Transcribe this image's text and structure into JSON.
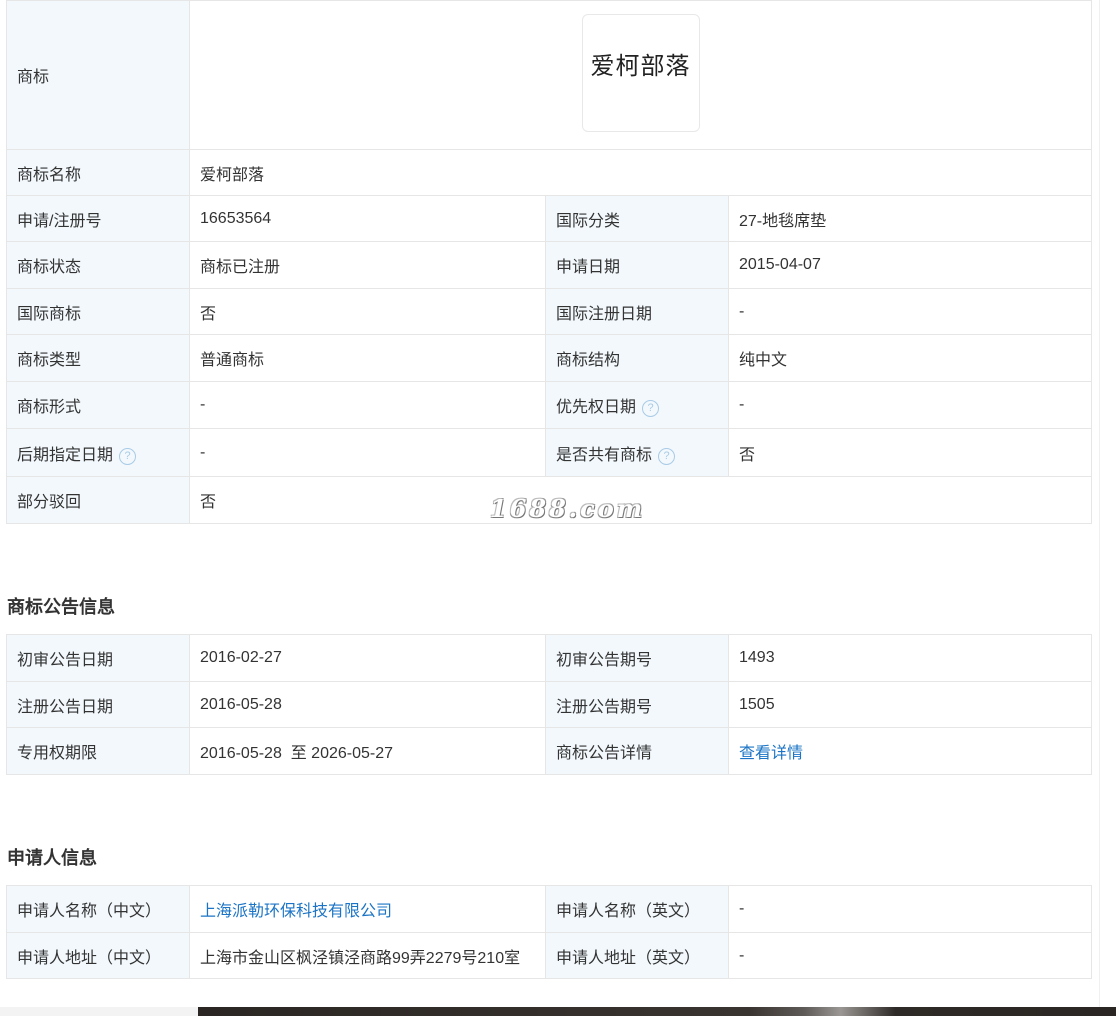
{
  "trademark": {
    "logo_label": "商标",
    "logo_text": "爱柯部落",
    "rows": [
      {
        "label": "商标名称",
        "value": "爱柯部落"
      },
      {
        "label": "申请/注册号",
        "value": "16653564",
        "label2": "国际分类",
        "value2": "27-地毯席垫"
      },
      {
        "label": "商标状态",
        "value": "商标已注册",
        "label2": "申请日期",
        "value2": "2015-04-07"
      },
      {
        "label": "国际商标",
        "value": "否",
        "label2": "国际注册日期",
        "value2": "-"
      },
      {
        "label": "商标类型",
        "value": "普通商标",
        "label2": "商标结构",
        "value2": "纯中文"
      },
      {
        "label": "商标形式",
        "value": "-",
        "label2": "优先权日期",
        "value2": "-"
      },
      {
        "label": "后期指定日期",
        "value": "-",
        "label2": "是否共有商标",
        "value2": "否"
      },
      {
        "label": "部分驳回",
        "value": "否"
      }
    ],
    "help_icon": "?"
  },
  "watermark": "1688.com",
  "announcement": {
    "title": "商标公告信息",
    "rows": [
      {
        "label": "初审公告日期",
        "value": "2016-02-27",
        "label2": "初审公告期号",
        "value2": "1493"
      },
      {
        "label": "注册公告日期",
        "value": "2016-05-28",
        "label2": "注册公告期号",
        "value2": "1505"
      },
      {
        "label": "专用权期限",
        "value": "2016-05-28  至 2026-05-27",
        "label2": "商标公告详情",
        "value2": "查看详情"
      }
    ]
  },
  "applicant": {
    "title": "申请人信息",
    "rows": [
      {
        "label": "申请人名称（中文）",
        "value": "上海派勒环保科技有限公司",
        "label2": "申请人名称（英文）",
        "value2": "-"
      },
      {
        "label": "申请人地址（中文）",
        "value": "上海市金山区枫泾镇泾商路99弄2279号210室",
        "label2": "申请人地址（英文）",
        "value2": "-"
      }
    ]
  },
  "colors": {
    "label_bg": "#f2f8fc",
    "border": "#e6e6e6",
    "link": "#1b74c5"
  }
}
